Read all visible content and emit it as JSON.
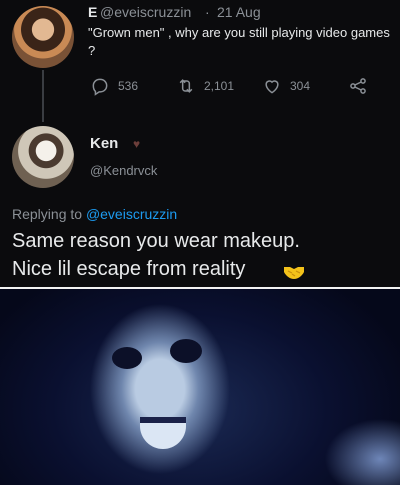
{
  "tweet": {
    "name": "E",
    "handle": "@eveiscruzzin",
    "separator": "·",
    "date": "21 Aug",
    "text": "\"Grown men\" , why are you still playing video games ?",
    "reply_count": "536",
    "retweet_count": "2,101",
    "like_count": "304"
  },
  "reply": {
    "name": "Ken",
    "handle": "@Kendrvck",
    "replying_prefix": "Replying to",
    "replying_handle": "@eveiscruzzin",
    "line1": "Same reason you wear makeup.",
    "line2": "Nice lil escape from reality"
  },
  "icons": {
    "reply": "reply-icon",
    "retweet": "retweet-icon",
    "like": "heart-icon",
    "share": "share-icon",
    "emoji": "handshake-emoji-icon",
    "accent": "#1d9bf0"
  }
}
